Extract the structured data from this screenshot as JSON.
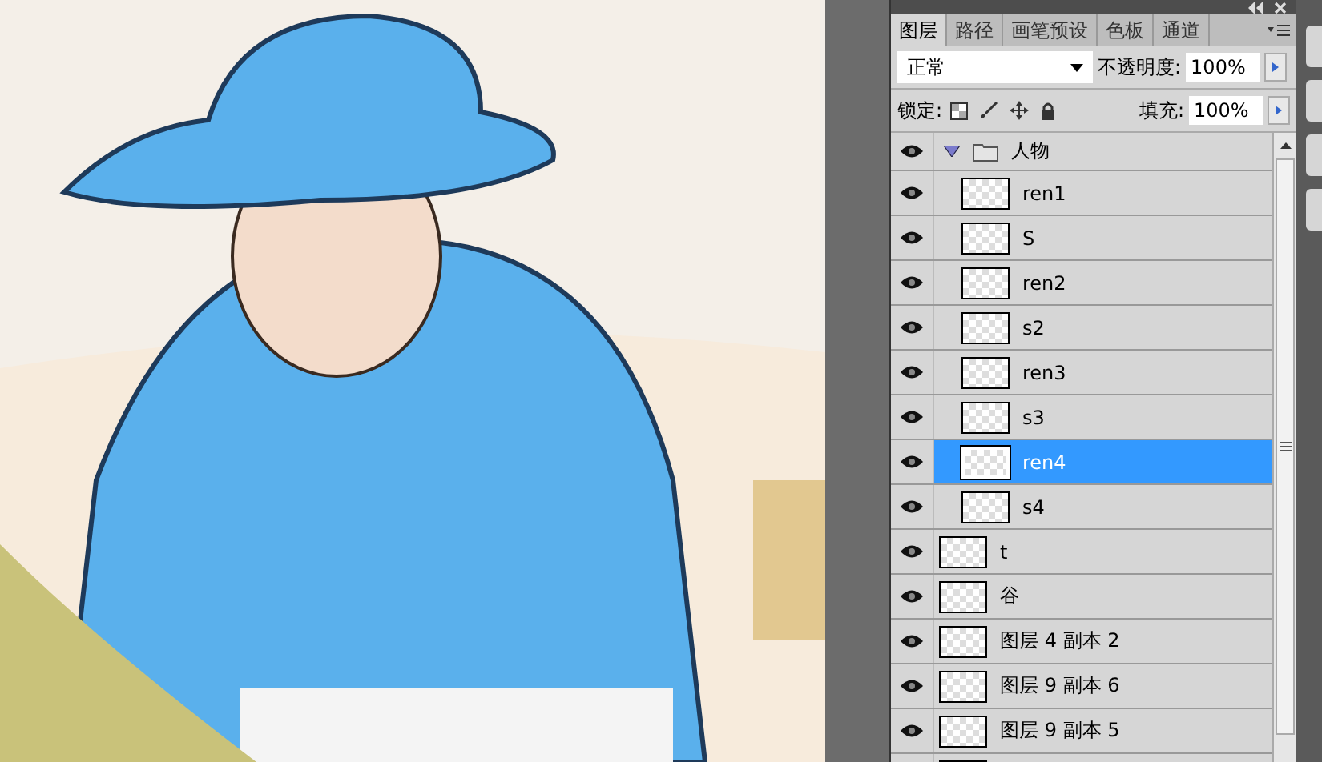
{
  "panel": {
    "tabs": [
      {
        "label": "图层",
        "selected": true
      },
      {
        "label": "路径",
        "selected": false
      },
      {
        "label": "画笔预设",
        "selected": false
      },
      {
        "label": "色板",
        "selected": false
      },
      {
        "label": "通道",
        "selected": false
      }
    ],
    "blend_mode": "正常",
    "opacity_label": "不透明度:",
    "opacity": "100%",
    "lock_label": "锁定:",
    "fill_label": "填充:",
    "fill": "100%",
    "layers": [
      {
        "kind": "group",
        "name": "人物",
        "visible": true,
        "selected": false,
        "expanded": true,
        "children": [
          {
            "kind": "layer",
            "name": "ren1",
            "visible": true,
            "selected": false
          },
          {
            "kind": "layer",
            "name": "S",
            "visible": true,
            "selected": false
          },
          {
            "kind": "layer",
            "name": "ren2",
            "visible": true,
            "selected": false
          },
          {
            "kind": "layer",
            "name": "s2",
            "visible": true,
            "selected": false
          },
          {
            "kind": "layer",
            "name": "ren3",
            "visible": true,
            "selected": false
          },
          {
            "kind": "layer",
            "name": "s3",
            "visible": true,
            "selected": false
          },
          {
            "kind": "layer",
            "name": "ren4",
            "visible": true,
            "selected": true
          },
          {
            "kind": "layer",
            "name": "s4",
            "visible": true,
            "selected": false
          }
        ]
      },
      {
        "kind": "layer",
        "name": "t",
        "visible": true,
        "selected": false
      },
      {
        "kind": "layer",
        "name": "谷",
        "visible": true,
        "selected": false
      },
      {
        "kind": "layer",
        "name": "图层 4 副本 2",
        "visible": true,
        "selected": false
      },
      {
        "kind": "layer",
        "name": "图层 9 副本 6",
        "visible": true,
        "selected": false
      },
      {
        "kind": "layer",
        "name": "图层 9 副本 5",
        "visible": true,
        "selected": false
      }
    ]
  }
}
